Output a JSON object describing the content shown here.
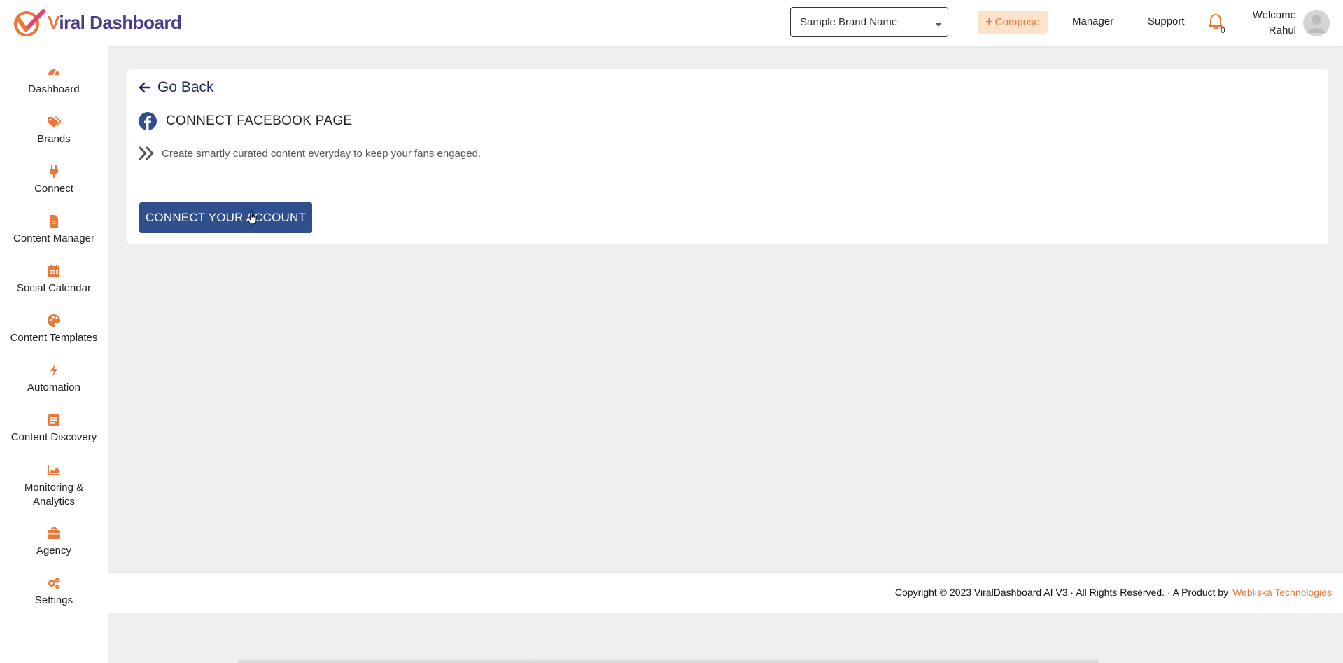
{
  "header": {
    "logo_text_v": "V",
    "logo_text_rest": "iral Dashboard",
    "brand_select_value": "Sample Brand Name",
    "compose_label": "Compose",
    "manager_label": "Manager",
    "support_label": "Support",
    "notification_count": "0",
    "welcome_line1": "Welcome",
    "welcome_line2": "Rahul"
  },
  "sidebar": {
    "items": [
      {
        "label": "Dashboard",
        "icon": "gauge-icon"
      },
      {
        "label": "Brands",
        "icon": "tags-icon"
      },
      {
        "label": "Connect",
        "icon": "plug-icon"
      },
      {
        "label": "Content Manager",
        "icon": "file-icon"
      },
      {
        "label": "Social Calendar",
        "icon": "calendar-icon"
      },
      {
        "label": "Content Templates",
        "icon": "palette-icon"
      },
      {
        "label": "Automation",
        "icon": "bolt-icon"
      },
      {
        "label": "Content Discovery",
        "icon": "document-icon"
      },
      {
        "label": "Monitoring & Analytics",
        "icon": "area-chart-icon"
      },
      {
        "label": "Agency",
        "icon": "briefcase-icon"
      },
      {
        "label": "Settings",
        "icon": "gears-icon"
      }
    ]
  },
  "main": {
    "go_back_label": "Go Back",
    "page_title": "CONNECT FACEBOOK PAGE",
    "description": "Create smartly curated content everyday to keep your fans engaged.",
    "connect_button_label": "CONNECT YOUR ACCOUNT"
  },
  "footer": {
    "copyright": "Copyright © 2023 ViralDashboard AI V3 · All Rights Reserved. · A Product by",
    "company_link": "Webliska Technologies"
  },
  "colors": {
    "accent": "#e9783a",
    "brand_purple": "#4a3b8c",
    "button_blue": "#2f4f8f",
    "facebook_blue": "#2f4f8f",
    "background": "#efefef"
  }
}
